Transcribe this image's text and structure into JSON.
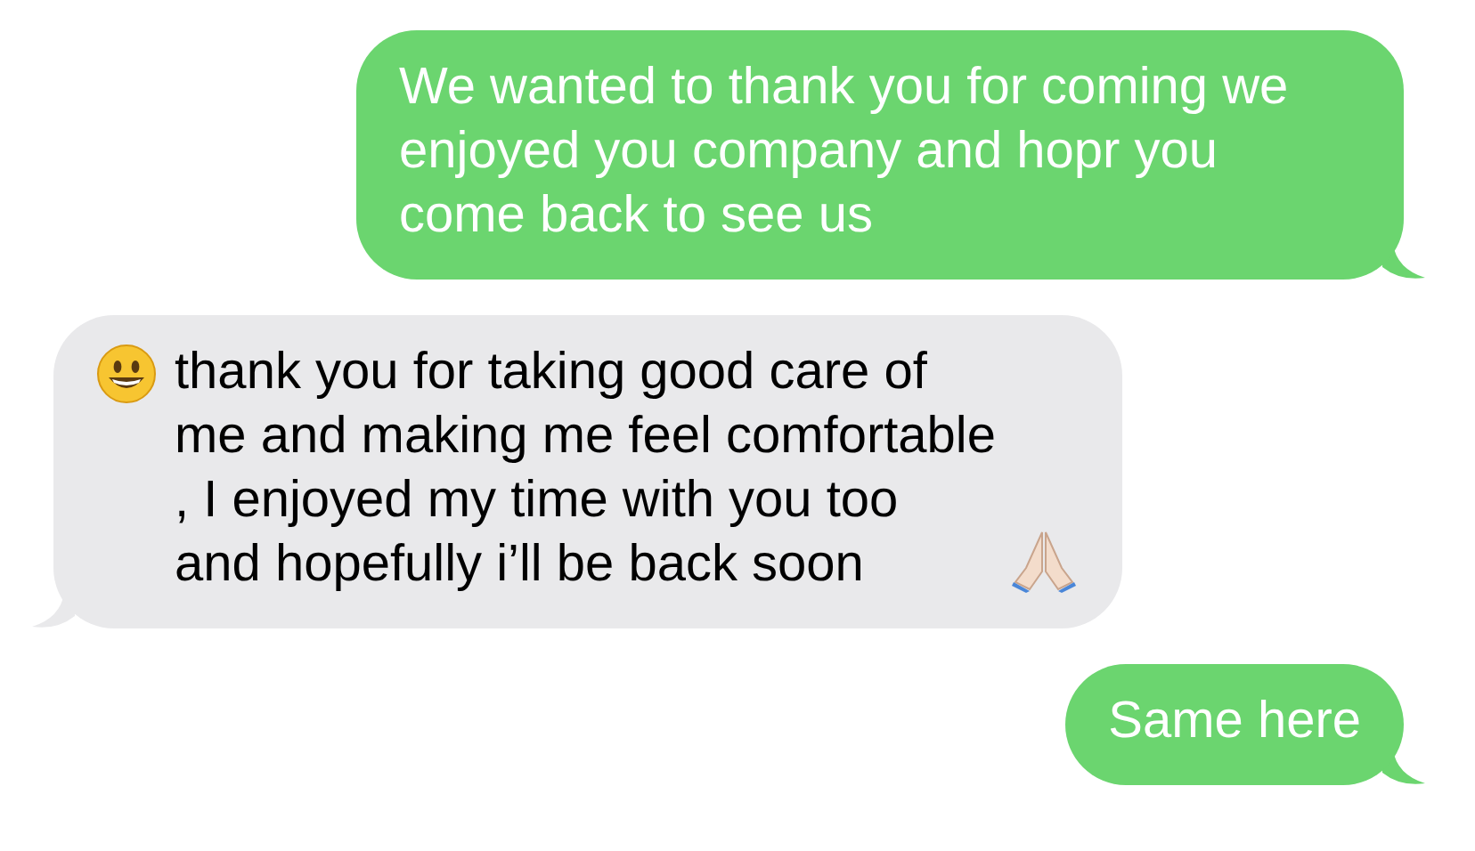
{
  "messages": [
    {
      "kind": "sent",
      "text": "We wanted to thank you for coming we enjoyed you company and hopr you come back to see us",
      "has_leading_emoji": false,
      "has_trailing_emoji": false
    },
    {
      "kind": "received",
      "text": "thank you for taking good care of me and making me feel comfortable , I enjoyed my time with you too and hopefully i’ll be back soon",
      "has_leading_emoji": true,
      "has_trailing_emoji": true
    },
    {
      "kind": "sent",
      "text": "Same here",
      "has_leading_emoji": false,
      "has_trailing_emoji": false
    }
  ]
}
